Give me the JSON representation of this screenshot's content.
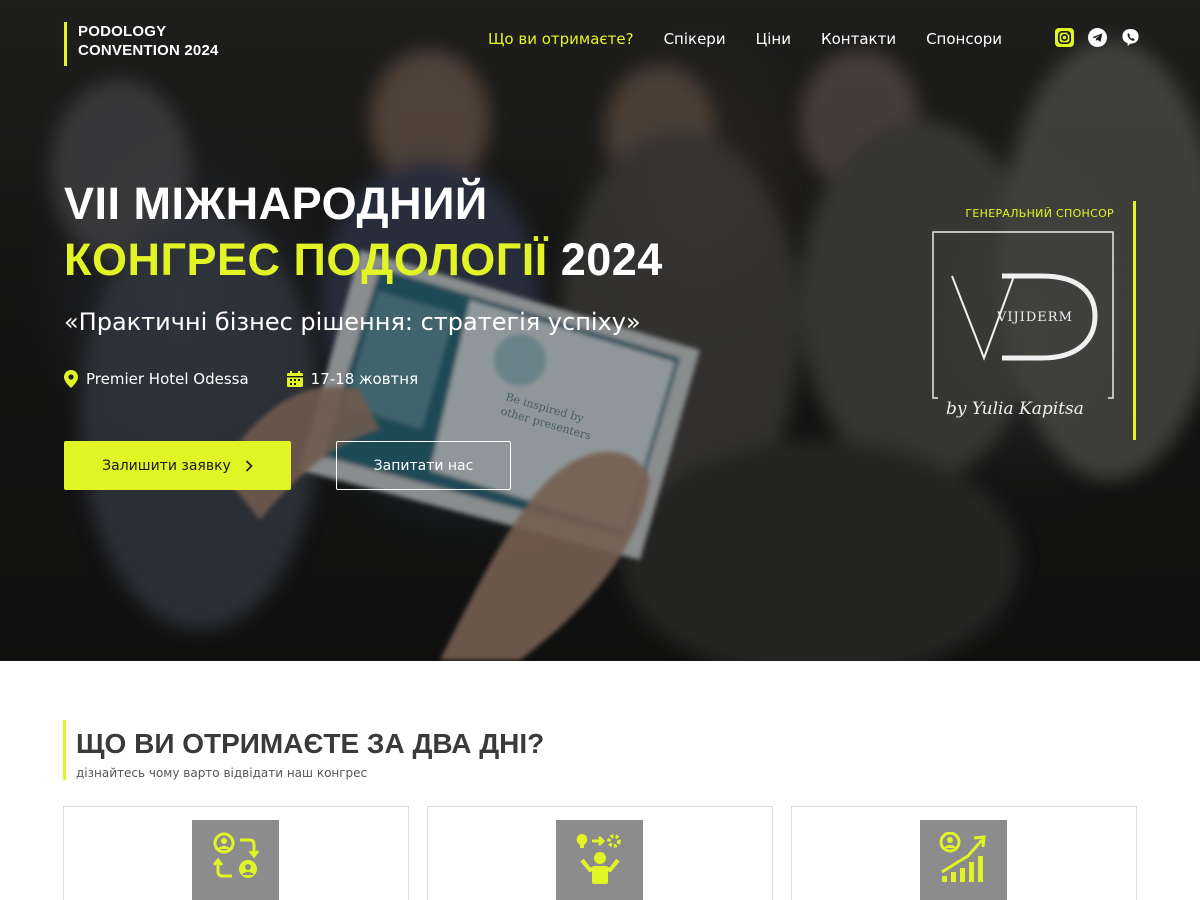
{
  "brand": {
    "line1": "PODOLOGY",
    "line2": "CONVENTION 2024",
    "accent_color": "#e1f526"
  },
  "nav": {
    "items": [
      {
        "label": "Що ви отримаєте?",
        "active": true
      },
      {
        "label": "Спікери",
        "active": false
      },
      {
        "label": "Ціни",
        "active": false
      },
      {
        "label": "Контакти",
        "active": false
      },
      {
        "label": "Спонсори",
        "active": false
      }
    ]
  },
  "social": {
    "icons": [
      "instagram-icon",
      "telegram-icon",
      "viber-icon"
    ]
  },
  "hero": {
    "title_line1": "VII МІЖНАРОДНИЙ",
    "title_accent": "КОНГРЕС ПОДОЛОГІЇ",
    "title_year": "2024",
    "subtitle": "«Практичні бізнес рішення: стратегія успіху»",
    "location": "Premier Hotel Odessa",
    "dates": "17-18 жовтня",
    "primary_button": "Залишити заявку",
    "secondary_button": "Запитати нас",
    "photo_text": [
      "Be inspired by",
      "other presenters"
    ]
  },
  "sponsor": {
    "label": "ГЕНЕРАЛЬНИЙ СПОНСОР",
    "logo_text": "VIJIDERM",
    "logo_signature": "by Yulia Kapitsa"
  },
  "section": {
    "title": "ЩО ВИ ОТРИМАЄТЕ ЗА ДВА ДНІ?",
    "subtitle": "дізнайтесь чому варто відвідати наш конгрес"
  },
  "cards": [
    {
      "icon": "people-exchange-icon"
    },
    {
      "icon": "ideas-person-icon"
    },
    {
      "icon": "growth-chart-person-icon"
    }
  ]
}
